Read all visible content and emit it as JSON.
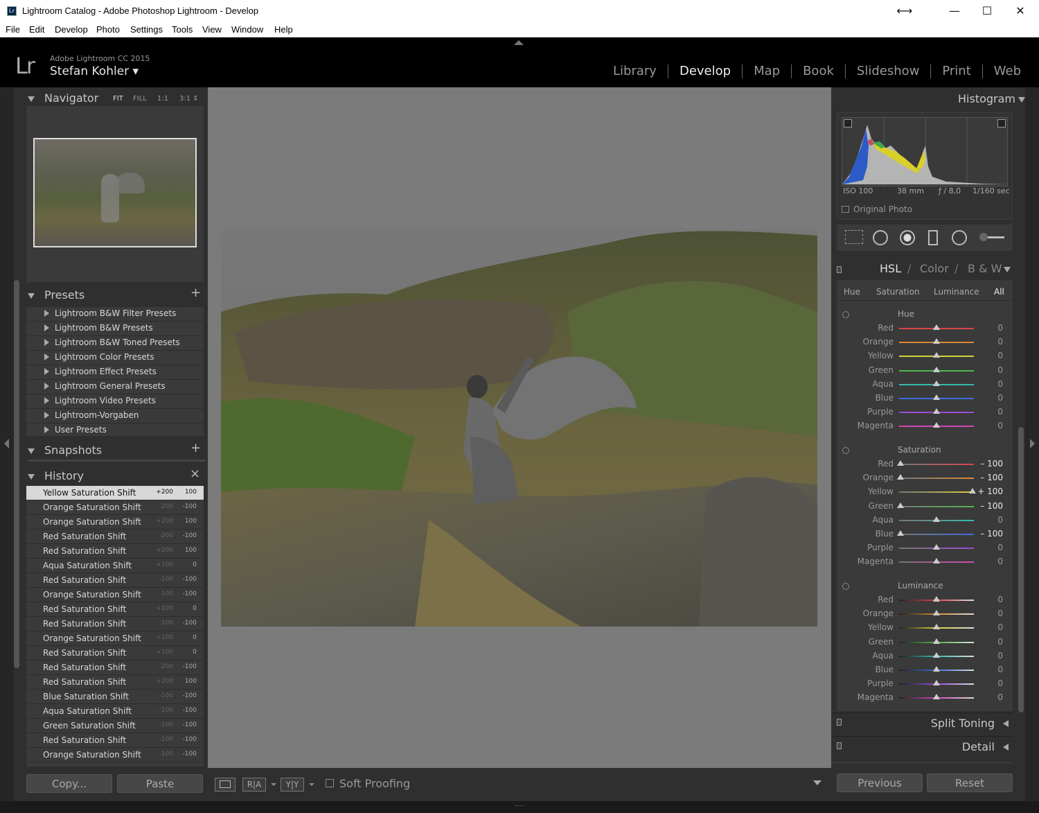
{
  "window": {
    "title": "Lightroom Catalog - Adobe Photoshop Lightroom - Develop",
    "app_icon": "Lr",
    "controls": [
      "⟷",
      "—",
      "☐",
      "✕"
    ]
  },
  "menu": [
    "File",
    "Edit",
    "Develop",
    "Photo",
    "Settings",
    "Tools",
    "View",
    "Window",
    "Help"
  ],
  "identity": {
    "logo": "Lr",
    "product": "Adobe Lightroom CC 2015",
    "user": "Stefan Kohler ▾"
  },
  "modules": [
    {
      "label": "Library",
      "active": false
    },
    {
      "label": "Develop",
      "active": true
    },
    {
      "label": "Map",
      "active": false
    },
    {
      "label": "Book",
      "active": false
    },
    {
      "label": "Slideshow",
      "active": false
    },
    {
      "label": "Print",
      "active": false
    },
    {
      "label": "Web",
      "active": false
    }
  ],
  "navigator": {
    "title": "Navigator",
    "zoom_options": [
      "FIT",
      "FILL",
      "1:1",
      "3:1 ⇕"
    ]
  },
  "presets": {
    "title": "Presets",
    "add": "+",
    "items": [
      "Lightroom B&W Filter Presets",
      "Lightroom B&W Presets",
      "Lightroom B&W Toned Presets",
      "Lightroom Color Presets",
      "Lightroom Effect Presets",
      "Lightroom General Presets",
      "Lightroom Video Presets",
      "Lightroom-Vorgaben",
      "User Presets"
    ]
  },
  "snapshots": {
    "title": "Snapshots",
    "add": "+"
  },
  "history": {
    "title": "History",
    "clear": "×",
    "items": [
      {
        "name": "Yellow Saturation Shift",
        "delta": "+200",
        "value": "100"
      },
      {
        "name": "Orange Saturation Shift",
        "delta": "-200",
        "value": "-100"
      },
      {
        "name": "Orange Saturation Shift",
        "delta": "+200",
        "value": "100"
      },
      {
        "name": "Red Saturation Shift",
        "delta": "-200",
        "value": "-100"
      },
      {
        "name": "Red Saturation Shift",
        "delta": "+200",
        "value": "100"
      },
      {
        "name": "Aqua Saturation Shift",
        "delta": "+100",
        "value": "0"
      },
      {
        "name": "Red Saturation Shift",
        "delta": "-100",
        "value": "-100"
      },
      {
        "name": "Orange Saturation Shift",
        "delta": "-100",
        "value": "-100"
      },
      {
        "name": "Red Saturation Shift",
        "delta": "+100",
        "value": "0"
      },
      {
        "name": "Red Saturation Shift",
        "delta": "-100",
        "value": "-100"
      },
      {
        "name": "Orange Saturation Shift",
        "delta": "+100",
        "value": "0"
      },
      {
        "name": "Red Saturation Shift",
        "delta": "+100",
        "value": "0"
      },
      {
        "name": "Red Saturation Shift",
        "delta": "-200",
        "value": "-100"
      },
      {
        "name": "Red Saturation Shift",
        "delta": "+200",
        "value": "100"
      },
      {
        "name": "Blue Saturation Shift",
        "delta": "-100",
        "value": "-100"
      },
      {
        "name": "Aqua Saturation Shift",
        "delta": "-100",
        "value": "-100"
      },
      {
        "name": "Green Saturation Shift",
        "delta": "-100",
        "value": "-100"
      },
      {
        "name": "Red Saturation Shift",
        "delta": "-100",
        "value": "-100"
      },
      {
        "name": "Orange Saturation Shift",
        "delta": "-100",
        "value": "-100"
      }
    ]
  },
  "left_buttons": {
    "copy": "Copy...",
    "paste": "Paste"
  },
  "toolbar": {
    "view_icon": "loupe-view-icon",
    "before_after_1": "R|A",
    "before_after_2": "Y|Y",
    "soft_proofing": "Soft Proofing"
  },
  "histogram": {
    "title": "Histogram",
    "iso": "ISO 100",
    "focal": "38 mm",
    "aperture": "ƒ / 8,0",
    "shutter": "1/160 sec",
    "original_photo": "Original Photo"
  },
  "hsl": {
    "tab_hsl": "HSL",
    "sep": "/",
    "tab_color": "Color",
    "tab_bw": "B & W",
    "subtabs": [
      "Hue",
      "Saturation",
      "Luminance",
      "All"
    ],
    "groups": [
      {
        "title": "Hue",
        "rows": [
          {
            "label": "Red",
            "value": "0",
            "level": 0
          },
          {
            "label": "Orange",
            "value": "0",
            "level": 0
          },
          {
            "label": "Yellow",
            "value": "0",
            "level": 0
          },
          {
            "label": "Green",
            "value": "0",
            "level": 0
          },
          {
            "label": "Aqua",
            "value": "0",
            "level": 0
          },
          {
            "label": "Blue",
            "value": "0",
            "level": 0
          },
          {
            "label": "Purple",
            "value": "0",
            "level": 0
          },
          {
            "label": "Magenta",
            "value": "0",
            "level": 0
          }
        ]
      },
      {
        "title": "Saturation",
        "rows": [
          {
            "label": "Red",
            "value": "– 100",
            "level": -100
          },
          {
            "label": "Orange",
            "value": "– 100",
            "level": -100
          },
          {
            "label": "Yellow",
            "value": "+ 100",
            "level": 100
          },
          {
            "label": "Green",
            "value": "– 100",
            "level": -100
          },
          {
            "label": "Aqua",
            "value": "0",
            "level": 0
          },
          {
            "label": "Blue",
            "value": "– 100",
            "level": -100
          },
          {
            "label": "Purple",
            "value": "0",
            "level": 0
          },
          {
            "label": "Magenta",
            "value": "0",
            "level": 0
          }
        ]
      },
      {
        "title": "Luminance",
        "rows": [
          {
            "label": "Red",
            "value": "0",
            "level": 0
          },
          {
            "label": "Orange",
            "value": "0",
            "level": 0
          },
          {
            "label": "Yellow",
            "value": "0",
            "level": 0
          },
          {
            "label": "Green",
            "value": "0",
            "level": 0
          },
          {
            "label": "Aqua",
            "value": "0",
            "level": 0
          },
          {
            "label": "Blue",
            "value": "0",
            "level": 0
          },
          {
            "label": "Purple",
            "value": "0",
            "level": 0
          },
          {
            "label": "Magenta",
            "value": "0",
            "level": 0
          }
        ]
      }
    ]
  },
  "collapsed_panels": [
    "Split Toning",
    "Detail"
  ],
  "right_buttons": {
    "previous": "Previous",
    "reset": "Reset"
  },
  "colors": {
    "Red": "#d8464c",
    "Orange": "#d98a3a",
    "Yellow": "#d8cf3c",
    "Green": "#4fb84d",
    "Aqua": "#3ab8b0",
    "Blue": "#3d6ed8",
    "Purple": "#9a4bd2",
    "Magenta": "#d247b4"
  }
}
